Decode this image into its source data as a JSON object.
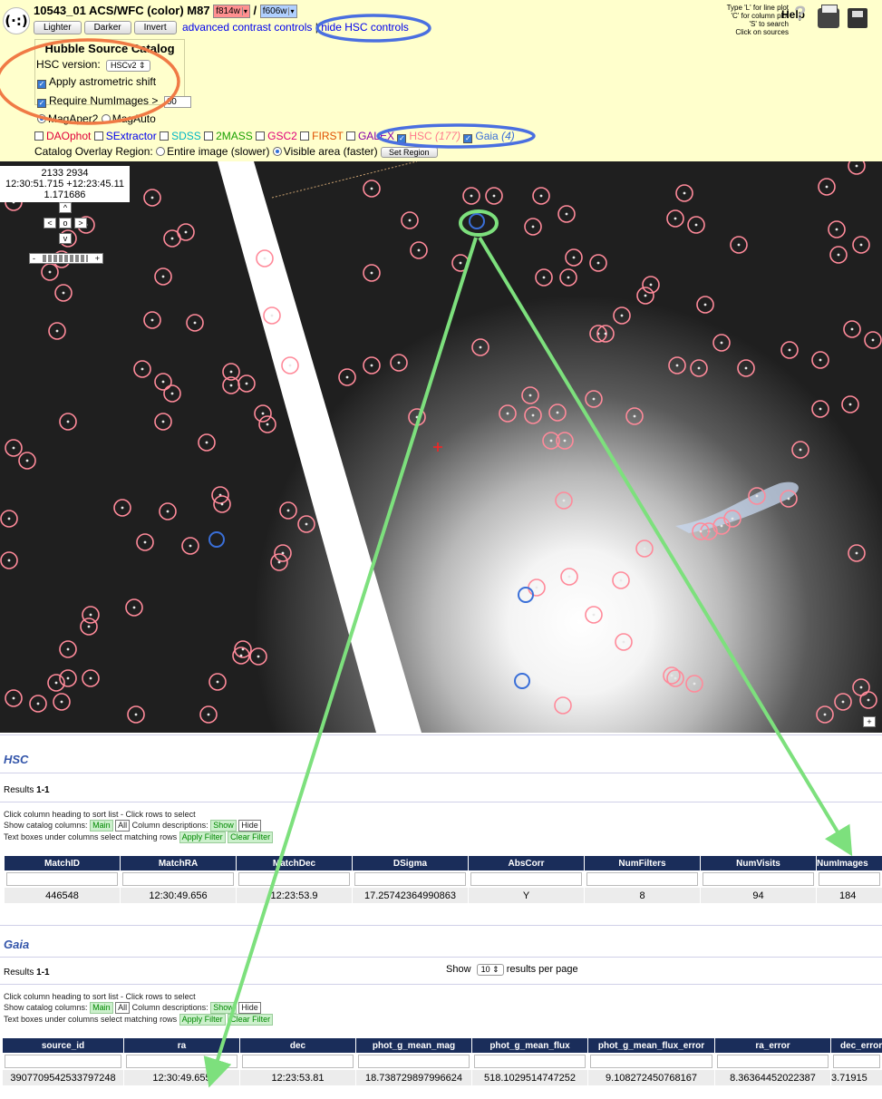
{
  "header": {
    "logo_text": "(·:)",
    "title": "10543_01 ACS/WFC (color) M87",
    "filter_red": "f814w",
    "separator": "/",
    "filter_blue": "f606w",
    "buttons": {
      "lighter": "Lighter",
      "darker": "Darker",
      "invert": "Invert"
    },
    "advanced_link": "advanced contrast controls",
    "pipe": "|",
    "hide_hsc_link": "hide HSC controls",
    "help_text_1": "Type 'L' for line plot",
    "help_text_2": "'C' for column plot",
    "help_text_3": "'S' to search",
    "help_text_4": "Click on sources",
    "help_label": "Help"
  },
  "hsc_controls": {
    "heading": "Hubble Source Catalog",
    "version_label": "HSC version:",
    "version_value": "HSCv2",
    "astrometric": "Apply astrometric shift",
    "numimages_label": "Require NumImages >",
    "numimages_value": "60",
    "mag_aper": "MagAper2",
    "mag_auto": "MagAuto"
  },
  "catalogs": {
    "daophot": "DAOphot",
    "sextractor": "SExtractor",
    "sdss": "SDSS",
    "twomass": "2MASS",
    "gsc2": "GSC2",
    "first": "FIRST",
    "galex": "GALEX",
    "hsc": "HSC",
    "hsc_count": "(177)",
    "gaia": "Gaia",
    "gaia_count": "(4)",
    "colors": {
      "daophot": "#e0003a",
      "sextractor": "#0000ee",
      "sdss": "#00b7c4",
      "twomass": "#19a000",
      "gsc2": "#e0007a",
      "first": "#e05000",
      "galex": "#8800aa",
      "hsc": "#ff7a8c",
      "gaia": "#3a6fd8"
    }
  },
  "overlay_region": {
    "label": "Catalog Overlay Region:",
    "entire": "Entire image (slower)",
    "visible": "Visible area (faster)",
    "set_region": "Set Region"
  },
  "viewer": {
    "pixel_xy": "2133 2934",
    "radec": "12:30:51.715 +12:23:45.11",
    "value": "1.171686",
    "nav_up": "^",
    "nav_left": "<",
    "nav_center": "o",
    "nav_right": ">",
    "nav_down": "v",
    "zoom_minus": "-",
    "zoom_plus": "+",
    "corner_plus": "+"
  },
  "hsc_table": {
    "title": "HSC",
    "results_prefix": "Results",
    "results_range": "1-1",
    "info_1": "Click column heading to sort list - Click rows to select",
    "info_2a": "Show catalog columns:",
    "main_btn": "Main",
    "all_btn": "All",
    "info_2b": "Column descriptions:",
    "show_btn": "Show",
    "hide_btn": "Hide",
    "info_3": "Text boxes under columns select matching rows",
    "apply_btn": "Apply Filter",
    "clear_btn": "Clear Filter",
    "columns": [
      "MatchID",
      "MatchRA",
      "MatchDec",
      "DSigma",
      "AbsCorr",
      "NumFilters",
      "NumVisits",
      "NumImages"
    ],
    "row": [
      "446548",
      "12:30:49.656",
      "12:23:53.9",
      "17.25742364990863",
      "Y",
      "8",
      "94",
      "184"
    ]
  },
  "gaia_table": {
    "title": "Gaia",
    "results_prefix": "Results",
    "results_range": "1-1",
    "show_label": "Show",
    "per_page": "10",
    "per_page_suffix": "results per page",
    "info_1": "Click column heading to sort list - Click rows to select",
    "info_2a": "Show catalog columns:",
    "main_btn": "Main",
    "all_btn": "All",
    "info_2b": "Column descriptions:",
    "show_btn": "Show",
    "hide_btn": "Hide",
    "info_3": "Text boxes under columns select matching rows",
    "apply_btn": "Apply Filter",
    "clear_btn": "Clear Filter",
    "columns": [
      "source_id",
      "ra",
      "dec",
      "phot_g_mean_mag",
      "phot_g_mean_flux",
      "phot_g_mean_flux_error",
      "ra_error",
      "dec_error"
    ],
    "row": [
      "3907709542533797248",
      "12:30:49.655",
      "12:23:53.81",
      "18.738729897996624",
      "518.1029514747252",
      "9.108272450768167",
      "8.36364452022387",
      "3.71915"
    ]
  }
}
